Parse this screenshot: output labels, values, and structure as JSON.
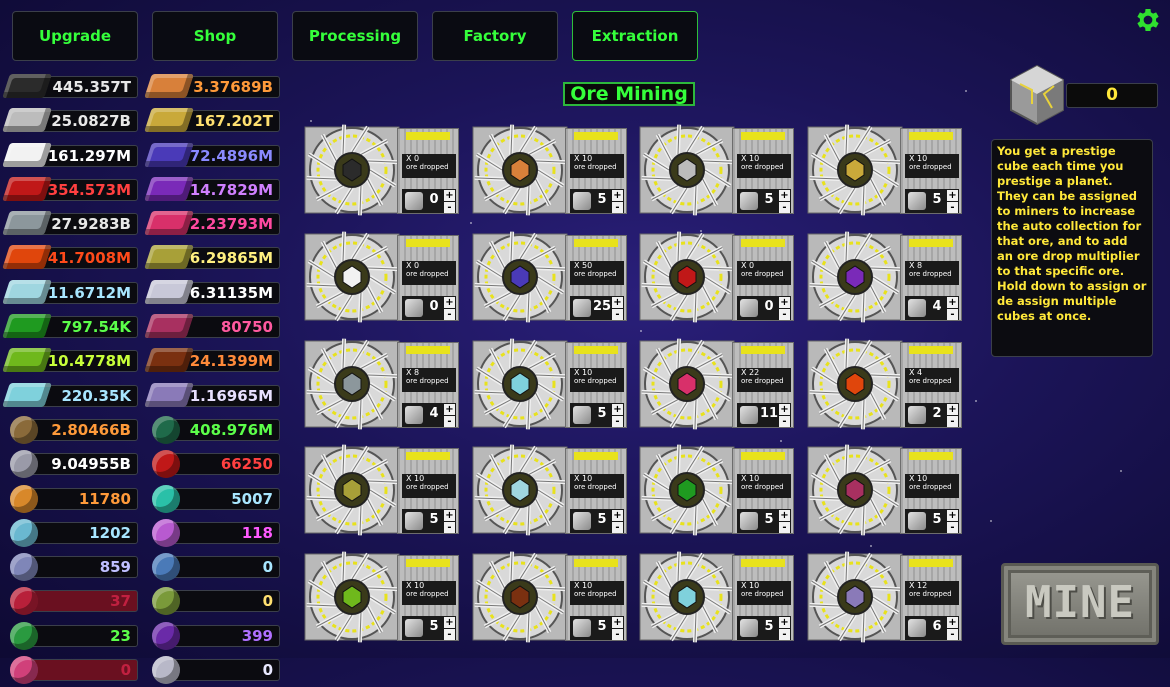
{
  "tabs": [
    {
      "label": "Upgrade"
    },
    {
      "label": "Shop"
    },
    {
      "label": "Processing"
    },
    {
      "label": "Factory"
    },
    {
      "label": "Extraction"
    }
  ],
  "title": "Ore Mining",
  "resources_left": [
    {
      "value": "445.357T",
      "color": "#e8e8e8",
      "icon": "dark-ore-bar-icon",
      "icolor": "#2b2b2b"
    },
    {
      "value": "25.0827B",
      "color": "#e8e8e8",
      "icon": "iron-bar-icon",
      "icolor": "#bcbcbc"
    },
    {
      "value": "161.297M",
      "color": "#ffffff",
      "icon": "silver-bar-icon",
      "icolor": "#f2f2f2"
    },
    {
      "value": "354.573M",
      "color": "#ff4040",
      "icon": "ruby-bar-icon",
      "icolor": "#c01818"
    },
    {
      "value": "27.9283B",
      "color": "#e8e8e8",
      "icon": "steel-bar-icon",
      "icolor": "#8c979c"
    },
    {
      "value": "41.7008M",
      "color": "#ff4a1a",
      "icon": "lava-bar-icon",
      "icolor": "#e0460c"
    },
    {
      "value": "11.6712M",
      "color": "#a8e6ff",
      "icon": "ice-bar-icon",
      "icolor": "#9fd6e0"
    },
    {
      "value": "797.54K",
      "color": "#5cff4a",
      "icon": "emerald-bar-icon",
      "icolor": "#1f9a20"
    },
    {
      "value": "10.4778M",
      "color": "#c8ff3a",
      "icon": "toxic-bar-icon",
      "icolor": "#6fb81c"
    },
    {
      "value": "220.35K",
      "color": "#a8e6ff",
      "icon": "crystal-bar-icon",
      "icolor": "#7fd1dc"
    },
    {
      "value": "2.80466B",
      "color": "#ff9a3a",
      "icon": "canister-icon",
      "icolor": "#8a6a3a"
    },
    {
      "value": "9.04955B",
      "color": "#ffffff",
      "icon": "plate-icon",
      "icolor": "#9a9aa8"
    },
    {
      "value": "11780",
      "color": "#ff9a3a",
      "icon": "orange-capsule-icon",
      "icolor": "#d8882a"
    },
    {
      "value": "1202",
      "color": "#a8e6ff",
      "icon": "blue-capsule-icon",
      "icolor": "#6ab8d0"
    },
    {
      "value": "859",
      "color": "#c0c0ff",
      "icon": "purple-capsule-icon",
      "icolor": "#7f86b8"
    },
    {
      "value": "37",
      "color": "#c02040",
      "icon": "red-chip-icon",
      "icolor": "#b8203a"
    },
    {
      "value": "23",
      "color": "#5cff4a",
      "icon": "green-gem-icon",
      "icolor": "#2a9a40"
    },
    {
      "value": "0",
      "color": "#c02040",
      "icon": "pink-chip-icon",
      "icolor": "#d0407a"
    }
  ],
  "resources_right": [
    {
      "value": "3.37689B",
      "color": "#ff9a3a",
      "icon": "copper-bar-icon",
      "icolor": "#d8803a"
    },
    {
      "value": "167.202T",
      "color": "#ffe070",
      "icon": "gold-bar-icon",
      "icolor": "#c9a93a"
    },
    {
      "value": "72.4896M",
      "color": "#8a8aff",
      "icon": "amethyst-bar-icon",
      "icolor": "#4a3ab8"
    },
    {
      "value": "14.7829M",
      "color": "#d080ff",
      "icon": "violet-bar-icon",
      "icolor": "#7a2ab8"
    },
    {
      "value": "2.23793M",
      "color": "#ff4aa0",
      "icon": "pink-bar-icon",
      "icolor": "#d8306a"
    },
    {
      "value": "6.29865M",
      "color": "#fff080",
      "icon": "olive-bar-icon",
      "icolor": "#a8a038"
    },
    {
      "value": "6.31135M",
      "color": "#ffffff",
      "icon": "platinum-bar-icon",
      "icolor": "#c8c8d8"
    },
    {
      "value": "80750",
      "color": "#ff5aa0",
      "icon": "rose-bar-icon",
      "icolor": "#a83060"
    },
    {
      "value": "24.1399M",
      "color": "#ff8a3a",
      "icon": "magma-bar-icon",
      "icolor": "#7a3010"
    },
    {
      "value": "1.16965M",
      "color": "#e8e0ff",
      "icon": "lilac-bar-icon",
      "icolor": "#8a7ab8"
    },
    {
      "value": "408.976M",
      "color": "#5cff4a",
      "icon": "circuit-board-icon",
      "icolor": "#1f6a4a"
    },
    {
      "value": "66250",
      "color": "#ff4040",
      "icon": "red-fuel-can-icon",
      "icolor": "#c01818"
    },
    {
      "value": "5007",
      "color": "#a8e6ff",
      "icon": "teal-capsule-icon",
      "icolor": "#2ac0a8"
    },
    {
      "value": "118",
      "color": "#ff5aff",
      "icon": "rainbow-orb-icon",
      "icolor": "#b85ad0"
    },
    {
      "value": "0",
      "color": "#a8e6ff",
      "icon": "device-icon",
      "icolor": "#4a7ab8"
    },
    {
      "value": "0",
      "color": "#ffe070",
      "icon": "green-orb-icon",
      "icolor": "#7a9a3a"
    },
    {
      "value": "399",
      "color": "#b070ff",
      "icon": "nebula-icon",
      "icolor": "#6a2aa8"
    },
    {
      "value": "0",
      "color": "#e8e8ff",
      "icon": "core-sphere-icon",
      "icolor": "#b8b8c8"
    }
  ],
  "miners": [
    {
      "count": "X 0",
      "assigned": "0",
      "ore_color": "#2b2b2b"
    },
    {
      "count": "X 10",
      "assigned": "5",
      "ore_color": "#d8803a"
    },
    {
      "count": "X 10",
      "assigned": "5",
      "ore_color": "#bcbcbc"
    },
    {
      "count": "X 10",
      "assigned": "5",
      "ore_color": "#c9a93a"
    },
    {
      "count": "X 0",
      "assigned": "0",
      "ore_color": "#f2f2f2"
    },
    {
      "count": "X 50",
      "assigned": "25",
      "ore_color": "#4a3ab8"
    },
    {
      "count": "X 0",
      "assigned": "0",
      "ore_color": "#c01818"
    },
    {
      "count": "X 8",
      "assigned": "4",
      "ore_color": "#7a2ab8"
    },
    {
      "count": "X 8",
      "assigned": "4",
      "ore_color": "#8c979c"
    },
    {
      "count": "X 10",
      "assigned": "5",
      "ore_color": "#7fd1dc"
    },
    {
      "count": "X 22",
      "assigned": "11",
      "ore_color": "#d8306a"
    },
    {
      "count": "X 4",
      "assigned": "2",
      "ore_color": "#e0460c"
    },
    {
      "count": "X 10",
      "assigned": "5",
      "ore_color": "#a8a038"
    },
    {
      "count": "X 10",
      "assigned": "5",
      "ore_color": "#9fd6e0"
    },
    {
      "count": "X 10",
      "assigned": "5",
      "ore_color": "#1f9a20"
    },
    {
      "count": "X 10",
      "assigned": "5",
      "ore_color": "#a83060"
    },
    {
      "count": "X 10",
      "assigned": "5",
      "ore_color": "#6fb81c"
    },
    {
      "count": "X 10",
      "assigned": "5",
      "ore_color": "#7a3010"
    },
    {
      "count": "X 10",
      "assigned": "5",
      "ore_color": "#7fd1dc"
    },
    {
      "count": "X 12",
      "assigned": "6",
      "ore_color": "#8a7ab8"
    }
  ],
  "ore_dropped_label": "ore dropped",
  "plus": "+",
  "minus": "-",
  "prestige": {
    "count": "0"
  },
  "description": "You get a prestige cube each time you prestige a planet. They can be assigned to miners to increase the auto collection for that ore, and to add an ore drop multiplier to that specific ore. Hold down to assign or de assign multiple cubes at once.",
  "mine_label": "MINE",
  "accent": "#35ff3b"
}
